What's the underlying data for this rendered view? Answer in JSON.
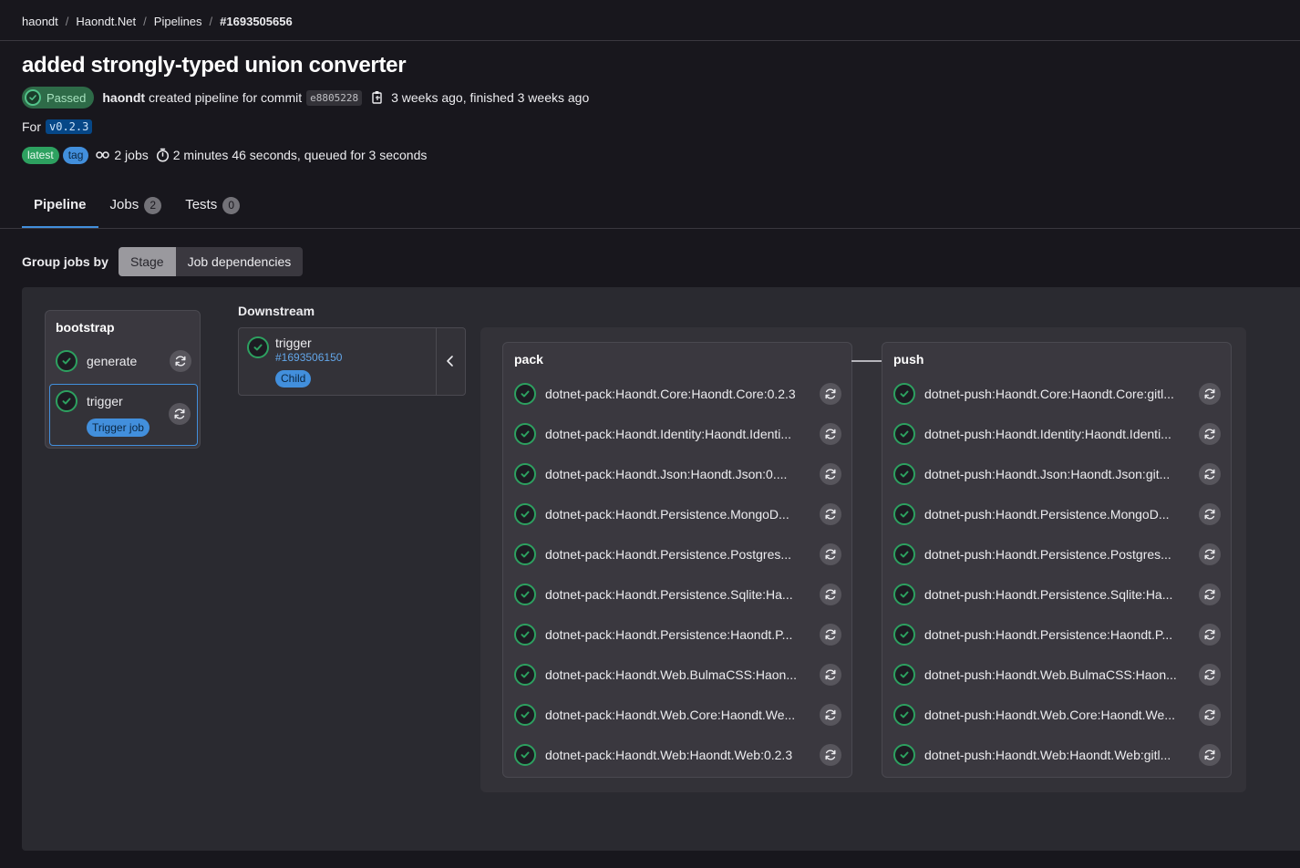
{
  "breadcrumb": [
    "haondt",
    "Haondt.Net",
    "Pipelines",
    "#1693505656"
  ],
  "title": "added strongly-typed union converter",
  "status_badge": "Passed",
  "meta": {
    "author": "haondt",
    "created_text": "created pipeline for commit",
    "sha": "e8805228",
    "ago": "3 weeks ago, finished 3 weeks ago"
  },
  "for_label": "For",
  "ref": "v0.2.3",
  "tags": [
    "latest",
    "tag"
  ],
  "jobs_text": "2 jobs",
  "duration_text": "2 minutes 46 seconds, queued for 3 seconds",
  "tabs": [
    {
      "label": "Pipeline",
      "count": null
    },
    {
      "label": "Jobs",
      "count": "2"
    },
    {
      "label": "Tests",
      "count": "0"
    }
  ],
  "group_by": {
    "label": "Group jobs by",
    "options": [
      "Stage",
      "Job dependencies"
    ],
    "selected": "Stage"
  },
  "bootstrap": {
    "title": "bootstrap",
    "jobs": [
      "generate",
      "trigger"
    ],
    "trigger_badge": "Trigger job"
  },
  "downstream": {
    "title": "Downstream",
    "job": "trigger",
    "pipeline_id": "#1693506150",
    "badge": "Child"
  },
  "pack": {
    "title": "pack",
    "jobs": [
      "dotnet-pack:Haondt.Core:Haondt.Core:0.2.3",
      "dotnet-pack:Haondt.Identity:Haondt.Identi...",
      "dotnet-pack:Haondt.Json:Haondt.Json:0....",
      "dotnet-pack:Haondt.Persistence.MongoD...",
      "dotnet-pack:Haondt.Persistence.Postgres...",
      "dotnet-pack:Haondt.Persistence.Sqlite:Ha...",
      "dotnet-pack:Haondt.Persistence:Haondt.P...",
      "dotnet-pack:Haondt.Web.BulmaCSS:Haon...",
      "dotnet-pack:Haondt.Web.Core:Haondt.We...",
      "dotnet-pack:Haondt.Web:Haondt.Web:0.2.3"
    ]
  },
  "push": {
    "title": "push",
    "jobs": [
      "dotnet-push:Haondt.Core:Haondt.Core:gitl...",
      "dotnet-push:Haondt.Identity:Haondt.Identi...",
      "dotnet-push:Haondt.Json:Haondt.Json:git...",
      "dotnet-push:Haondt.Persistence.MongoD...",
      "dotnet-push:Haondt.Persistence.Postgres...",
      "dotnet-push:Haondt.Persistence.Sqlite:Ha...",
      "dotnet-push:Haondt.Persistence:Haondt.P...",
      "dotnet-push:Haondt.Web.BulmaCSS:Haon...",
      "dotnet-push:Haondt.Web.Core:Haondt.We...",
      "dotnet-push:Haondt.Web:Haondt.Web:gitl..."
    ]
  },
  "icons": {
    "status": "check-circle-icon",
    "retry": "retry-icon",
    "copy": "copy-icon",
    "jobs": "pipeline-icon",
    "duration": "timer-icon",
    "collapse": "chevron-left-icon"
  },
  "colors": {
    "success": "#2da160",
    "accent": "#428fdc",
    "background": "#18171d"
  }
}
